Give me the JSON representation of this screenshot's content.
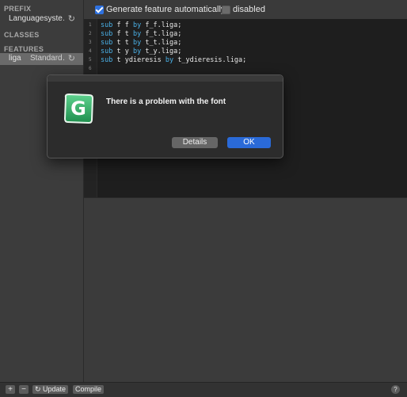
{
  "sidebar": {
    "prefix_header": "PREFIX",
    "prefix_item": "Languagesyste…",
    "classes_header": "CLASSES",
    "features_header": "FEATURES",
    "feature_tag": "liga",
    "feature_desc": "Standard…",
    "refresh_glyph": "↻"
  },
  "options": {
    "generate_label": "Generate feature automatically",
    "generate_checked": true,
    "disabled_label": "disabled",
    "disabled_checked": false
  },
  "editor": {
    "lines": [
      {
        "num": "1",
        "kw1": "sub",
        "a": " f f ",
        "kw2": "by",
        "b": " f_f.liga;"
      },
      {
        "num": "2",
        "kw1": "sub",
        "a": " f t ",
        "kw2": "by",
        "b": " f_t.liga;"
      },
      {
        "num": "3",
        "kw1": "sub",
        "a": " t t ",
        "kw2": "by",
        "b": " t_t.liga;"
      },
      {
        "num": "4",
        "kw1": "sub",
        "a": " t y ",
        "kw2": "by",
        "b": " t_y.liga;"
      },
      {
        "num": "5",
        "kw1": "sub",
        "a": " t ydieresis ",
        "kw2": "by",
        "b": " t_ydieresis.liga;"
      },
      {
        "num": "6",
        "kw1": "",
        "a": "",
        "kw2": "",
        "b": ""
      }
    ]
  },
  "dialog": {
    "message": "There is a problem with the font",
    "details_label": "Details",
    "ok_label": "OK",
    "icon": "glyphs-app-icon",
    "icon_letter": "G"
  },
  "bottombar": {
    "add_glyph": "+",
    "remove_glyph": "−",
    "update_label": "↻ Update",
    "compile_label": "Compile",
    "help_glyph": "?"
  },
  "colors": {
    "accent": "#2a6ad8",
    "keyword": "#4ab0e6",
    "icon_green": "#2fb36a"
  }
}
